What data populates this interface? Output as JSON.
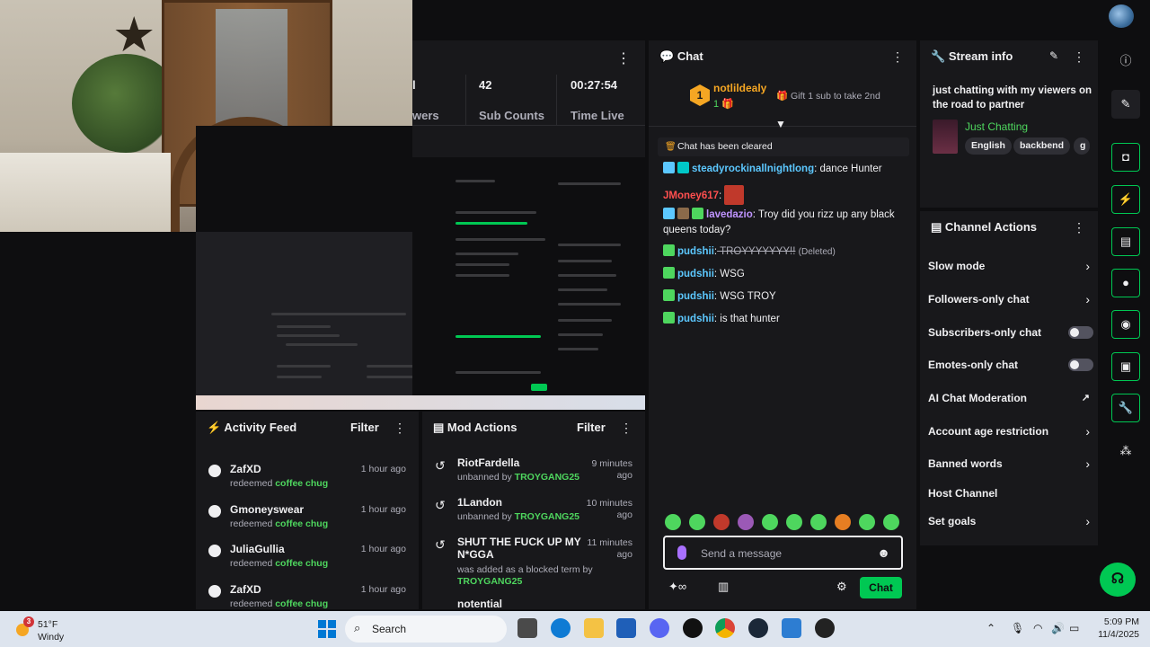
{
  "stats": {
    "partial_left_value": "l",
    "partial_left_label": "wers",
    "sub_counts_value": "42",
    "sub_counts_label": "Sub Counts",
    "time_live_value": "00:27:54",
    "time_live_label": "Time Live"
  },
  "activity_feed": {
    "title": "Activity Feed",
    "filter_label": "Filter",
    "items": [
      {
        "name": "ZafXD",
        "action": "redeemed",
        "reward": "coffee chug",
        "time": "1 hour ago"
      },
      {
        "name": "Gmoneyswear",
        "action": "redeemed",
        "reward": "coffee chug",
        "time": "1 hour ago"
      },
      {
        "name": "JuliaGullia",
        "action": "redeemed",
        "reward": "coffee chug",
        "time": "1 hour ago"
      },
      {
        "name": "ZafXD",
        "action": "redeemed",
        "reward": "coffee chug",
        "time": "1 hour ago"
      }
    ]
  },
  "mod_actions": {
    "title": "Mod Actions",
    "filter_label": "Filter",
    "items": [
      {
        "name": "RiotFardella",
        "action": "unbanned by",
        "moderator": "TROYGANG25",
        "time": "9 minutes ago"
      },
      {
        "name": "1Landon",
        "action": "unbanned by",
        "moderator": "TROYGANG25",
        "time": "10 minutes ago"
      },
      {
        "name": "SHUT THE FUCK UP MY N*GGA",
        "action": "was added as a blocked term by",
        "moderator": "TROYGANG25",
        "time": "11 minutes ago"
      },
      {
        "name": "notential",
        "action": "",
        "moderator": "",
        "time": ""
      }
    ]
  },
  "chat": {
    "title": "Chat",
    "gift": {
      "rank": "1",
      "user": "notlildealy",
      "count": "1",
      "text": "Gift 1 sub to take 2nd"
    },
    "cleared_text": "Chat has been cleared",
    "messages": [
      {
        "user": "steadyrockinallnightlong",
        "sep": ":",
        "text": " dance Hunter",
        "color": "#5cc8ff"
      },
      {
        "user": "JMoney617",
        "sep": ":",
        "text": "",
        "color": "#ff4f4f"
      },
      {
        "user": "lavedazio",
        "sep": ":",
        "text": " Troy did you rizz up any black queens today?",
        "color": "#bf94ff"
      },
      {
        "user": "pudshii",
        "sep": ":",
        "text": " TROYYYYYYY!!",
        "note": "(Deleted)",
        "color": "#5cc8ff"
      },
      {
        "user": "pudshii",
        "sep": ":",
        "text": " WSG",
        "color": "#5cc8ff"
      },
      {
        "user": "pudshii",
        "sep": ":",
        "text": " WSG TROY",
        "color": "#5cc8ff"
      },
      {
        "user": "pudshii",
        "sep": ":",
        "text": " is that hunter",
        "color": "#5cc8ff"
      }
    ],
    "input_placeholder": "Send a message",
    "send_label": "Chat"
  },
  "stream_info": {
    "title_label": "Stream info",
    "title": "just chatting with my viewers on the road to partner",
    "category": "Just Chatting",
    "tags": [
      "English",
      "backbend",
      "g"
    ]
  },
  "channel_actions": {
    "title": "Channel Actions",
    "items": [
      {
        "label": "Slow mode",
        "control": "chevron"
      },
      {
        "label": "Followers-only chat",
        "control": "chevron"
      },
      {
        "label": "Subscribers-only chat",
        "control": "toggle"
      },
      {
        "label": "Emotes-only chat",
        "control": "toggle"
      },
      {
        "label": "AI Chat Moderation",
        "control": "external"
      },
      {
        "label": "Account age restriction",
        "control": "chevron"
      },
      {
        "label": "Banned words",
        "control": "chevron"
      },
      {
        "label": "Host Channel",
        "control": "none"
      },
      {
        "label": "Set goals",
        "control": "chevron"
      }
    ]
  },
  "taskbar": {
    "weather_temp": "51°F",
    "weather_cond": "Windy",
    "notification_count": "3",
    "search_label": "Search",
    "time": "5:09 PM",
    "date": "11/4/2025"
  },
  "colors": {
    "accent_green": "#00c853",
    "highlight_green": "#4ed65e",
    "gift_gold": "#f5a623",
    "panel_bg": "#18181b",
    "page_bg": "#0e0e10"
  }
}
